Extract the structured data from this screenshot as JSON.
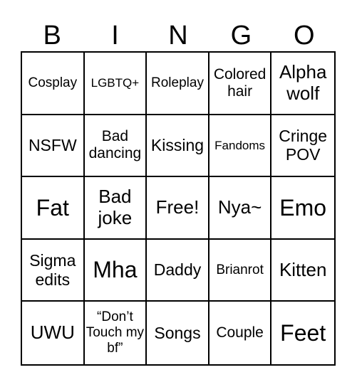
{
  "header": [
    "B",
    "I",
    "N",
    "G",
    "O"
  ],
  "cells": [
    [
      "Cosplay",
      "LGBTQ+",
      "Roleplay",
      "Colored hair",
      "Alpha wolf"
    ],
    [
      "NSFW",
      "Bad dancing",
      "Kissing",
      "Fandoms",
      "Cringe POV"
    ],
    [
      "Fat",
      "Bad joke",
      "Free!",
      "Nya~",
      "Emo"
    ],
    [
      "Sigma edits",
      "Mha",
      "Daddy",
      "Brianrot",
      "Kitten"
    ],
    [
      "UWU",
      "“Don’t Touch my bf”",
      "Songs",
      "Couple",
      "Feet"
    ]
  ]
}
